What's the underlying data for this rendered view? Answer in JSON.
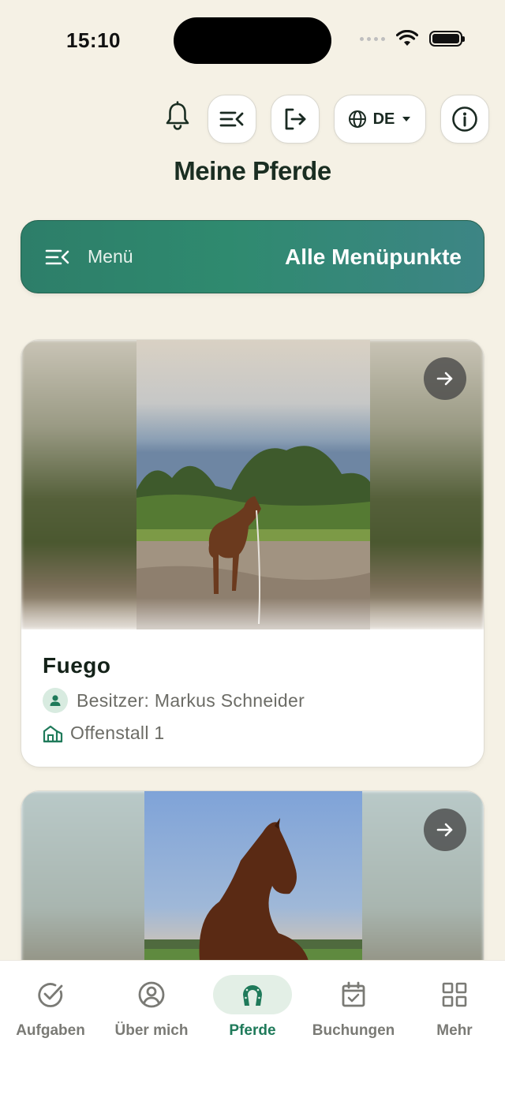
{
  "status_bar": {
    "time": "15:10"
  },
  "header": {
    "language_code": "DE",
    "icons": [
      "bell-icon",
      "menu-collapse-icon",
      "logout-icon",
      "globe-icon",
      "info-icon"
    ]
  },
  "page_title": "Meine Pferde",
  "menu_banner": {
    "label": "Menü",
    "action": "Alle Menüpunkte"
  },
  "horses": [
    {
      "name": "Fuego",
      "owner": "Besitzer: Markus Schneider",
      "stable": "Offenstall 1"
    }
  ],
  "bottom_nav": {
    "items": [
      {
        "label": "Aufgaben",
        "icon": "check-circle-icon"
      },
      {
        "label": "Über mich",
        "icon": "user-circle-icon"
      },
      {
        "label": "Pferde",
        "icon": "horseshoe-icon",
        "active": true
      },
      {
        "label": "Buchungen",
        "icon": "calendar-check-icon"
      },
      {
        "label": "Mehr",
        "icon": "grid-icon"
      }
    ]
  },
  "colors": {
    "accent": "#1f7a5a",
    "background": "#f5f1e5",
    "banner_start": "#2d7e69",
    "banner_end": "#3d8585"
  }
}
